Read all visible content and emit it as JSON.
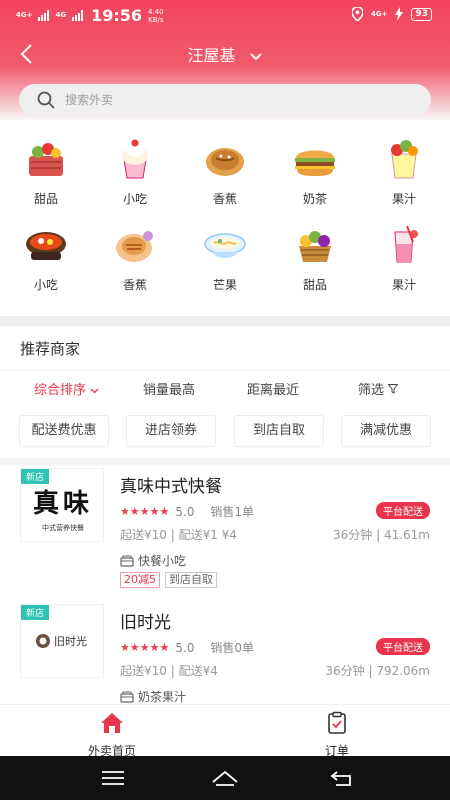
{
  "status": {
    "network1": "4G+",
    "network2": "4G",
    "time": "19:56",
    "speed_value": "4.40",
    "speed_unit": "KB/s",
    "network3": "4G+",
    "battery": "93"
  },
  "header": {
    "location": "汪屋基"
  },
  "search": {
    "placeholder": "搜索外卖"
  },
  "categories": [
    {
      "label": "甜品",
      "icon": "basket-icon"
    },
    {
      "label": "小吃",
      "icon": "cupcake-icon"
    },
    {
      "label": "香蕉",
      "icon": "pancake-icon"
    },
    {
      "label": "奶茶",
      "icon": "burger-icon"
    },
    {
      "label": "果汁",
      "icon": "fruit-cup-icon"
    },
    {
      "label": "小吃",
      "icon": "hotpot-icon"
    },
    {
      "label": "香蕉",
      "icon": "dessert-icon"
    },
    {
      "label": "芒果",
      "icon": "noodle-bowl-icon"
    },
    {
      "label": "甜品",
      "icon": "fruit-basket-icon"
    },
    {
      "label": "果汁",
      "icon": "juice-glass-icon"
    }
  ],
  "section_title": "推荐商家",
  "sort": {
    "comprehensive": "综合排序",
    "sales": "销量最高",
    "distance": "距离最近",
    "filter": "筛选"
  },
  "chips": [
    "配送费优惠",
    "进店领券",
    "到店自取",
    "满减优惠"
  ],
  "shops": [
    {
      "new_label": "新店",
      "logo_text": "真味",
      "logo_sub": "中式营养快餐",
      "name": "真味中式快餐",
      "stars": "★★★★★",
      "score": "5.0",
      "sales": "销售1单",
      "delivery_badge": "平台配送",
      "fees": "起送¥10 | 配送¥1  ¥4",
      "distance": "36分钟 | 41.61m",
      "category": "快餐小吃",
      "tags": [
        {
          "text": "20减5",
          "red": true
        },
        {
          "text": "到店自取",
          "red": false
        }
      ]
    },
    {
      "new_label": "新店",
      "logo_text": "旧时光",
      "name": "旧时光",
      "stars": "★★★★★",
      "score": "5.0",
      "sales": "销售0单",
      "delivery_badge": "平台配送",
      "fees": "起送¥10 | 配送¥4",
      "distance": "36分钟 | 792.06m",
      "category": "奶茶果汁"
    }
  ],
  "tabs": {
    "home": "外卖首页",
    "orders": "订单"
  },
  "colors": {
    "accent": "#e8354d",
    "header_top": "#f2435f",
    "new_badge": "#2fc3b3"
  }
}
